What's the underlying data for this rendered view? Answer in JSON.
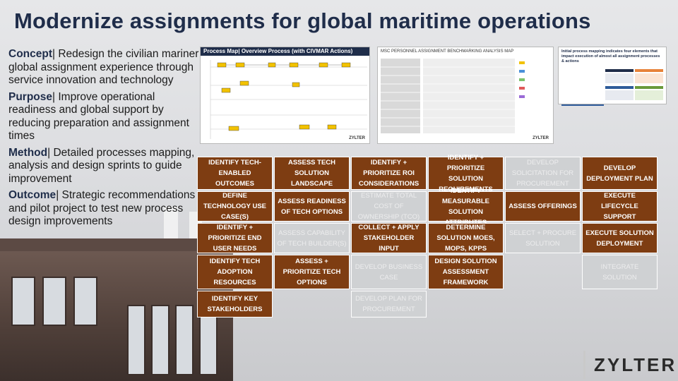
{
  "title": "Modernize assignments for global maritime operations",
  "sections": [
    {
      "label": "Concept",
      "separator": "|",
      "text": "Redesign the civilian mariner global assignment experience through service innovation and technology"
    },
    {
      "label": "Purpose",
      "separator": "|",
      "text": "Improve operational readiness and global support by reducing preparation and assignment times"
    },
    {
      "label": "Method",
      "separator": "|",
      "text": "Detailed processes mapping, analysis and design sprints to guide improvement"
    },
    {
      "label": "Outcome",
      "separator": "|",
      "text": "Strategic recommendations and pilot project to test new process design improvements"
    }
  ],
  "thumbnails": [
    {
      "title": "Process Map| Overview Process (with CIVMAR Actions)",
      "brand": "ZYLTER"
    },
    {
      "title": "MSC PERSONNEL ASSIGNMENT BENCHMARKING ANALYSIS MAP",
      "brand": "ZYLTER"
    },
    {
      "title": "Initial process mapping indicates four elements that impact execution of almost all assignment processes & actions"
    }
  ],
  "grid": [
    [
      {
        "text": "IDENTIFY TECH-ENABLED OUTCOMES",
        "state": "active"
      },
      {
        "text": "DEFINE TECHNOLOGY USE CASE(S)",
        "state": "active"
      },
      {
        "text": "IDENTIFY + PRIORITIZE END USER NEEDS",
        "state": "active"
      },
      {
        "text": "IDENTIFY TECH ADOPTION RESOURCES",
        "state": "active"
      },
      {
        "text": "IDENTIFY KEY STAKEHOLDERS",
        "state": "active"
      }
    ],
    [
      {
        "text": "ASSESS TECH SOLUTION LANDSCAPE",
        "state": "active"
      },
      {
        "text": "ASSESS READINESS OF TECH OPTIONS",
        "state": "active"
      },
      {
        "text": "ASSESS CAPABILITY OF TECH BUILDER(S)",
        "state": "inactive"
      },
      {
        "text": "ASSESS + PRIORITIZE TECH OPTIONS",
        "state": "active"
      }
    ],
    [
      {
        "text": "IDENTIFY + PRIORITIZE ROI CONSIDERATIONS",
        "state": "active"
      },
      {
        "text": "ESTIMATE TOTAL COST OF OWNERSHIP (TCO)",
        "state": "inactive"
      },
      {
        "text": "COLLECT + APPLY STAKEHOLDER INPUT",
        "state": "active"
      },
      {
        "text": "DEVELOP BUSINESS CASE",
        "state": "inactive"
      },
      {
        "text": "DEVELOP PLAN FOR PROCUREMENT",
        "state": "inactive"
      }
    ],
    [
      {
        "text": "IDENTIFY + PRIORITIZE SOLUTION REQUIREMENTS",
        "state": "active"
      },
      {
        "text": "IDENTIFY MEASURABLE SOLUTION ATTRIBUTES",
        "state": "active"
      },
      {
        "text": "DETERMINE SOLUTION MOES, MOPS, KPPS",
        "state": "active"
      },
      {
        "text": "DESIGN SOLUTION ASSESSMENT FRAMEWORK",
        "state": "active"
      }
    ],
    [
      {
        "text": "DEVELOP SOLICITATION FOR PROCUREMENT",
        "state": "inactive"
      },
      {
        "text": "ASSESS OFFERINGS",
        "state": "active"
      },
      {
        "text": "SELECT + PROCURE SOLUTION",
        "state": "inactive"
      }
    ],
    [
      {
        "text": "DEVELOP DEPLOYMENT PLAN",
        "state": "active"
      },
      {
        "text": "EXECUTE LIFECYCLE SUPPORT",
        "state": "active"
      },
      {
        "text": "EXECUTE SOLUTION DEPLOYMENT",
        "state": "active"
      },
      {
        "text": "INTEGRATE SOLUTION",
        "state": "inactive"
      }
    ]
  ],
  "logo": "ZYLTER",
  "colors": {
    "title": "#1f2d4a",
    "active_cell": "#7e3d12",
    "inactive_cell": "#cfd1d3"
  }
}
